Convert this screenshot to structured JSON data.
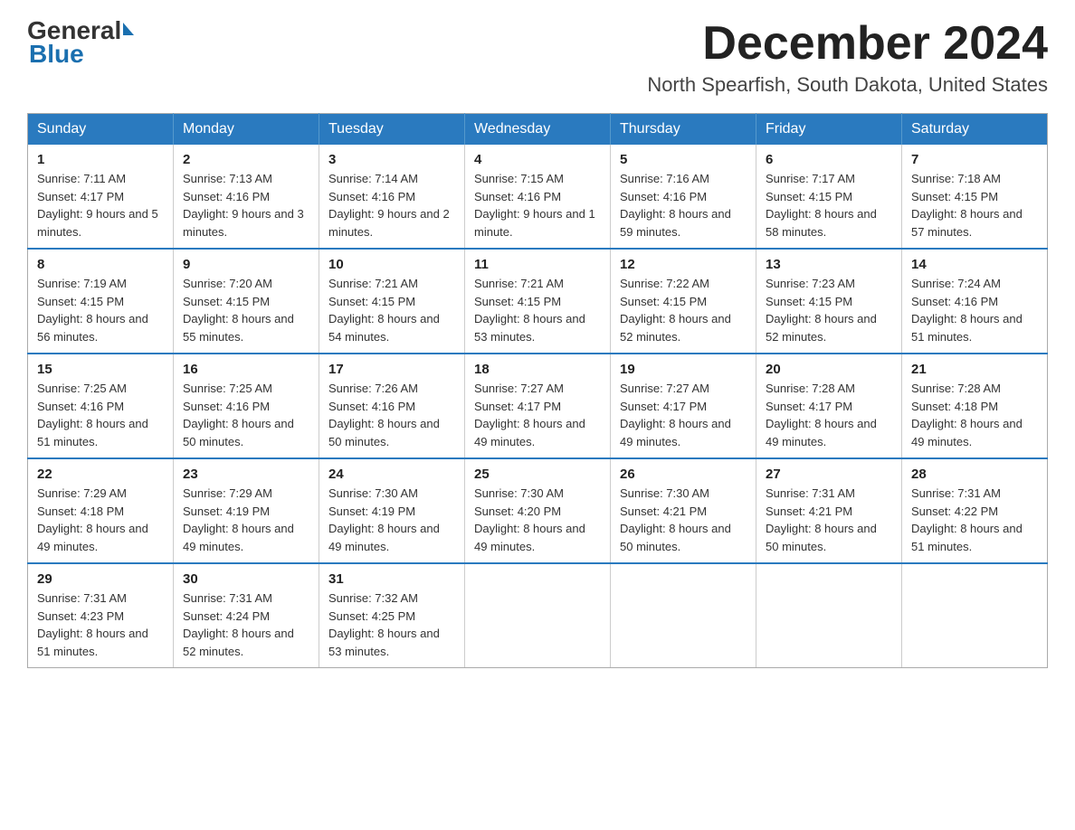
{
  "logo": {
    "general": "General",
    "blue": "Blue"
  },
  "header": {
    "month": "December 2024",
    "location": "North Spearfish, South Dakota, United States"
  },
  "weekdays": [
    "Sunday",
    "Monday",
    "Tuesday",
    "Wednesday",
    "Thursday",
    "Friday",
    "Saturday"
  ],
  "weeks": [
    [
      {
        "day": "1",
        "sunrise": "7:11 AM",
        "sunset": "4:17 PM",
        "daylight": "9 hours and 5 minutes."
      },
      {
        "day": "2",
        "sunrise": "7:13 AM",
        "sunset": "4:16 PM",
        "daylight": "9 hours and 3 minutes."
      },
      {
        "day": "3",
        "sunrise": "7:14 AM",
        "sunset": "4:16 PM",
        "daylight": "9 hours and 2 minutes."
      },
      {
        "day": "4",
        "sunrise": "7:15 AM",
        "sunset": "4:16 PM",
        "daylight": "9 hours and 1 minute."
      },
      {
        "day": "5",
        "sunrise": "7:16 AM",
        "sunset": "4:16 PM",
        "daylight": "8 hours and 59 minutes."
      },
      {
        "day": "6",
        "sunrise": "7:17 AM",
        "sunset": "4:15 PM",
        "daylight": "8 hours and 58 minutes."
      },
      {
        "day": "7",
        "sunrise": "7:18 AM",
        "sunset": "4:15 PM",
        "daylight": "8 hours and 57 minutes."
      }
    ],
    [
      {
        "day": "8",
        "sunrise": "7:19 AM",
        "sunset": "4:15 PM",
        "daylight": "8 hours and 56 minutes."
      },
      {
        "day": "9",
        "sunrise": "7:20 AM",
        "sunset": "4:15 PM",
        "daylight": "8 hours and 55 minutes."
      },
      {
        "day": "10",
        "sunrise": "7:21 AM",
        "sunset": "4:15 PM",
        "daylight": "8 hours and 54 minutes."
      },
      {
        "day": "11",
        "sunrise": "7:21 AM",
        "sunset": "4:15 PM",
        "daylight": "8 hours and 53 minutes."
      },
      {
        "day": "12",
        "sunrise": "7:22 AM",
        "sunset": "4:15 PM",
        "daylight": "8 hours and 52 minutes."
      },
      {
        "day": "13",
        "sunrise": "7:23 AM",
        "sunset": "4:15 PM",
        "daylight": "8 hours and 52 minutes."
      },
      {
        "day": "14",
        "sunrise": "7:24 AM",
        "sunset": "4:16 PM",
        "daylight": "8 hours and 51 minutes."
      }
    ],
    [
      {
        "day": "15",
        "sunrise": "7:25 AM",
        "sunset": "4:16 PM",
        "daylight": "8 hours and 51 minutes."
      },
      {
        "day": "16",
        "sunrise": "7:25 AM",
        "sunset": "4:16 PM",
        "daylight": "8 hours and 50 minutes."
      },
      {
        "day": "17",
        "sunrise": "7:26 AM",
        "sunset": "4:16 PM",
        "daylight": "8 hours and 50 minutes."
      },
      {
        "day": "18",
        "sunrise": "7:27 AM",
        "sunset": "4:17 PM",
        "daylight": "8 hours and 49 minutes."
      },
      {
        "day": "19",
        "sunrise": "7:27 AM",
        "sunset": "4:17 PM",
        "daylight": "8 hours and 49 minutes."
      },
      {
        "day": "20",
        "sunrise": "7:28 AM",
        "sunset": "4:17 PM",
        "daylight": "8 hours and 49 minutes."
      },
      {
        "day": "21",
        "sunrise": "7:28 AM",
        "sunset": "4:18 PM",
        "daylight": "8 hours and 49 minutes."
      }
    ],
    [
      {
        "day": "22",
        "sunrise": "7:29 AM",
        "sunset": "4:18 PM",
        "daylight": "8 hours and 49 minutes."
      },
      {
        "day": "23",
        "sunrise": "7:29 AM",
        "sunset": "4:19 PM",
        "daylight": "8 hours and 49 minutes."
      },
      {
        "day": "24",
        "sunrise": "7:30 AM",
        "sunset": "4:19 PM",
        "daylight": "8 hours and 49 minutes."
      },
      {
        "day": "25",
        "sunrise": "7:30 AM",
        "sunset": "4:20 PM",
        "daylight": "8 hours and 49 minutes."
      },
      {
        "day": "26",
        "sunrise": "7:30 AM",
        "sunset": "4:21 PM",
        "daylight": "8 hours and 50 minutes."
      },
      {
        "day": "27",
        "sunrise": "7:31 AM",
        "sunset": "4:21 PM",
        "daylight": "8 hours and 50 minutes."
      },
      {
        "day": "28",
        "sunrise": "7:31 AM",
        "sunset": "4:22 PM",
        "daylight": "8 hours and 51 minutes."
      }
    ],
    [
      {
        "day": "29",
        "sunrise": "7:31 AM",
        "sunset": "4:23 PM",
        "daylight": "8 hours and 51 minutes."
      },
      {
        "day": "30",
        "sunrise": "7:31 AM",
        "sunset": "4:24 PM",
        "daylight": "8 hours and 52 minutes."
      },
      {
        "day": "31",
        "sunrise": "7:32 AM",
        "sunset": "4:25 PM",
        "daylight": "8 hours and 53 minutes."
      },
      null,
      null,
      null,
      null
    ]
  ]
}
